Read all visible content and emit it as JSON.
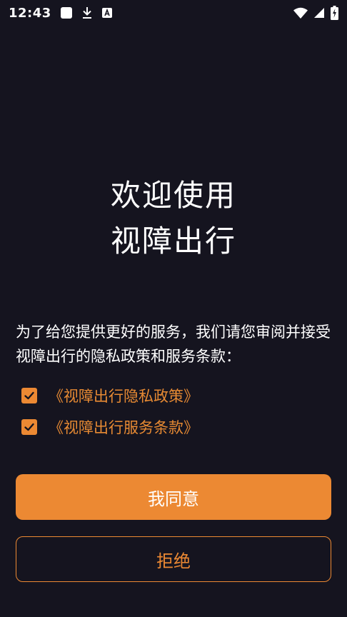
{
  "status_bar": {
    "time": "12:43",
    "icons": [
      "square-icon",
      "download-icon",
      "accessibility-icon",
      "wifi-icon",
      "signal-icon",
      "battery-charging-icon"
    ]
  },
  "welcome": {
    "line1": "欢迎使用",
    "line2": "视障出行"
  },
  "notice": {
    "text": "为了给您提供更好的服务，我们请您审阅并接受视障出行的隐私政策和服务条款："
  },
  "policies": [
    {
      "label": "《视障出行隐私政策》",
      "checked": true
    },
    {
      "label": "《视障出行服务条款》",
      "checked": true
    }
  ],
  "buttons": {
    "agree": "我同意",
    "reject": "拒绝"
  },
  "colors": {
    "background": "#15141f",
    "accent": "#ec8933",
    "text": "#ffffff"
  }
}
